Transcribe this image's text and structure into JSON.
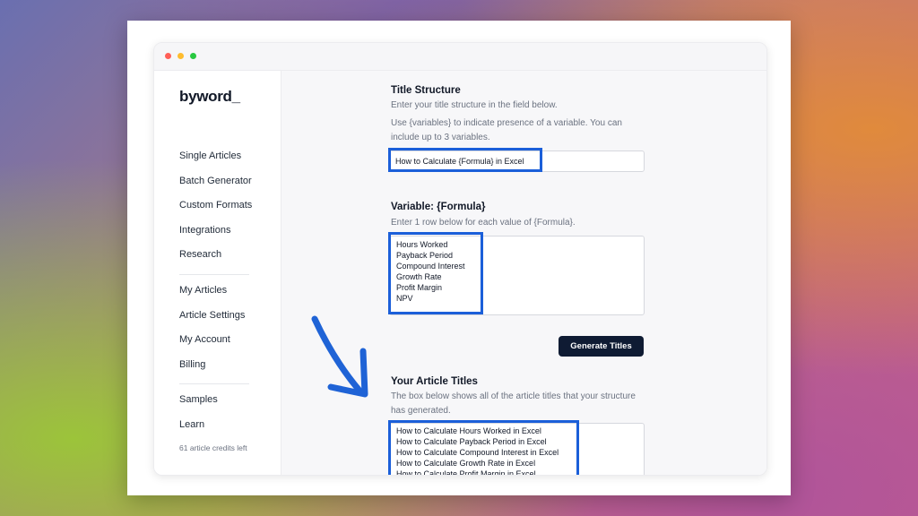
{
  "app": {
    "logo": "byword_"
  },
  "sidebar": {
    "group1": [
      "Single Articles",
      "Batch Generator",
      "Custom Formats",
      "Integrations",
      "Research"
    ],
    "group2": [
      "My Articles",
      "Article Settings",
      "My Account",
      "Billing"
    ],
    "group3": [
      "Samples",
      "Learn"
    ],
    "credits": "61 article credits left"
  },
  "title_structure": {
    "heading": "Title Structure",
    "help1": "Enter your title structure in the field below.",
    "help2": "Use {variables} to indicate presence of a variable. You can include up to 3 variables.",
    "value": "How to Calculate {Formula} in Excel"
  },
  "variable": {
    "heading": "Variable: {Formula}",
    "help": "Enter 1 row below for each value of {Formula}.",
    "values": [
      "Hours Worked",
      "Payback Period",
      "Compound Interest",
      "Growth Rate",
      "Profit Margin",
      "NPV"
    ]
  },
  "generate_button": "Generate Titles",
  "results": {
    "heading": "Your Article Titles",
    "help": "The box below shows all of the article titles that your structure has generated.",
    "titles": [
      "How to Calculate Hours Worked in Excel",
      "How to Calculate Payback Period in Excel",
      "How to Calculate Compound Interest in Excel",
      "How to Calculate Growth Rate in Excel",
      "How to Calculate Profit Margin in Excel"
    ]
  },
  "colors": {
    "highlight": "#1b5fd9",
    "button": "#0f1b33",
    "arrow": "#1f63d6"
  }
}
